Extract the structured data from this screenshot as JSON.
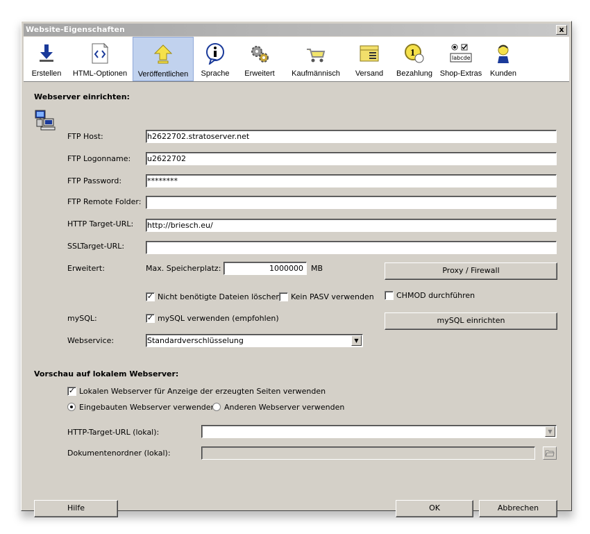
{
  "window": {
    "title": "Website-Eigenschaften",
    "close_label": "x"
  },
  "toolbar": {
    "items": [
      {
        "label": "Erstellen",
        "icon": "download-arrow-icon"
      },
      {
        "label": "HTML-Optionen",
        "icon": "html-code-icon"
      },
      {
        "label": "Veröffentlichen",
        "icon": "upload-arrow-icon",
        "active": true
      },
      {
        "label": "Sprache",
        "icon": "info-bubble-icon"
      },
      {
        "label": "Erweitert",
        "icon": "gears-icon"
      },
      {
        "label": "Kaufmännisch",
        "icon": "shopping-cart-icon"
      },
      {
        "label": "Versand",
        "icon": "package-icon"
      },
      {
        "label": "Bezahlung",
        "icon": "coin-icon"
      },
      {
        "label": "Shop-Extras",
        "icon": "form-controls-icon",
        "icon_text": "labcde"
      },
      {
        "label": "Kunden",
        "icon": "customer-icon"
      }
    ]
  },
  "webserver": {
    "title": "Webserver einrichten:",
    "ftp_host_label": "FTP Host:",
    "ftp_host_value": "h2622702.stratoserver.net",
    "ftp_login_label": "FTP Logonname:",
    "ftp_login_value": "u2622702",
    "ftp_password_label": "FTP Password:",
    "ftp_password_value": "********",
    "ftp_folder_label": "FTP Remote Folder:",
    "ftp_folder_value": "",
    "http_url_label": "HTTP Target-URL:",
    "http_url_value": "http://briesch.eu/",
    "ssl_url_label": "SSLTarget-URL:",
    "ssl_url_value": "",
    "erweitert_label": "Erweitert:",
    "storage_label": "Max. Speicherplatz:",
    "storage_value": "1000000",
    "storage_unit": "MB",
    "proxy_button": "Proxy / Firewall",
    "delete_files_label": "Nicht benötigte Dateien löschen",
    "delete_files_checked": true,
    "no_pasv_label": "Kein PASV verwenden",
    "no_pasv_checked": false,
    "chmod_label": "CHMOD durchführen",
    "chmod_checked": false,
    "mysql_label": "mySQL:",
    "mysql_use_label": "mySQL verwenden (empfohlen)",
    "mysql_use_checked": true,
    "mysql_button": "mySQL einrichten",
    "webservice_label": "Webservice:",
    "webservice_value": "Standardverschlüsselung"
  },
  "preview": {
    "title": "Vorschau auf lokalem Webserver:",
    "local_server_label": "Lokalen Webserver für Anzeige der erzeugten Seiten verwenden",
    "local_server_checked": true,
    "builtin_label": "Eingebauten Webserver verwenden",
    "builtin_selected": true,
    "other_label": "Anderen Webserver verwenden",
    "other_selected": false,
    "http_local_label": "HTTP-Target-URL (lokal):",
    "http_local_value": "",
    "docroot_label": "Dokumentenordner (lokal):",
    "docroot_value": ""
  },
  "footer": {
    "help_button": "Hilfe",
    "ok_button": "OK",
    "cancel_button": "Abbrechen"
  }
}
